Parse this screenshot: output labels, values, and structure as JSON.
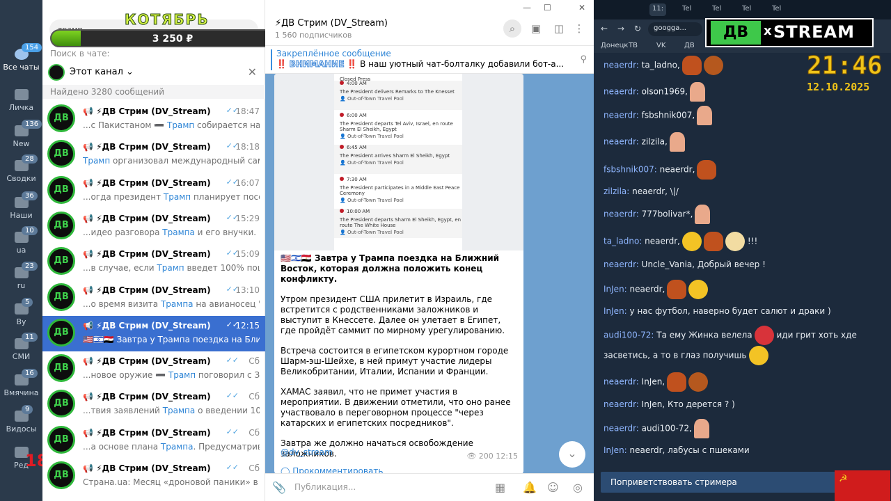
{
  "rail": {
    "items": [
      {
        "label": "Все чаты",
        "badge": "154"
      },
      {
        "label": "Личка",
        "badge": ""
      },
      {
        "label": "New",
        "badge": "136"
      },
      {
        "label": "Сводки",
        "badge": "28"
      },
      {
        "label": "Наши",
        "badge": "36"
      },
      {
        "label": "ua",
        "badge": "10"
      },
      {
        "label": "ru",
        "badge": "23"
      },
      {
        "label": "By",
        "badge": "5"
      },
      {
        "label": "СМИ",
        "badge": "11"
      },
      {
        "label": "Вмячина",
        "badge": "16"
      },
      {
        "label": "Видосы",
        "badge": "9"
      },
      {
        "label": "Ред",
        "badge": ""
      }
    ],
    "age_label": "18+"
  },
  "overlay": {
    "title": "КОТЯБРЬ",
    "amount": "3 250 ₽",
    "progress": 0.12
  },
  "list": {
    "search_value": "трамп",
    "search_in_chat": "Поиск в чате:",
    "channel_filter": "Этот канал",
    "found": "Найдено 3280 сообщений",
    "rows": [
      {
        "name": "📢 ⚡ДВ Стрим (DV_Stream)",
        "time": "18:47",
        "ticks": "✓✓",
        "pre": "...с Пакистаном ➖ ",
        "hl": "Трамп",
        "post": " собирается на Бли..."
      },
      {
        "name": "📢 ⚡ДВ Стрим (DV_Stream)",
        "time": "18:18",
        "ticks": "✓✓",
        "pre": "",
        "hl": "Трамп",
        "post": " организовал международный саммит п..."
      },
      {
        "name": "📢 ⚡ДВ Стрим (DV_Stream)",
        "time": "16:07",
        "ticks": "✓✓",
        "pre": "...огда президент ",
        "hl": "Трамп",
        "post": " планирует посетить Из..."
      },
      {
        "name": "📢 ⚡ДВ Стрим (DV_Stream)",
        "time": "15:29",
        "ticks": "✓✓",
        "pre": "...идео разговора ",
        "hl": "Трампа",
        "post": " и его внучки.   Вн..."
      },
      {
        "name": "📢 ⚡ДВ Стрим (DV_Stream)",
        "time": "15:09",
        "ticks": "✓✓",
        "pre": "...в случае, если ",
        "hl": "Трамп",
        "post": " введет 100% пошлины..."
      },
      {
        "name": "📢 ⚡ДВ Стрим (DV_Stream)",
        "time": "13:10",
        "ticks": "✓✓",
        "pre": "...о время визита ",
        "hl": "Трампа",
        "post": " на авианосец \"Гар..."
      },
      {
        "name": "📢 ⚡ДВ Стрим (DV_Stream)",
        "time": "12:15",
        "ticks": "✓✓",
        "pre": "🇺🇸🇮🇱🇪🇬 Завтра у Трампа поездка на Ближ...",
        "hl": "",
        "post": ""
      },
      {
        "name": "📢 ⚡ДВ Стрим (DV_Stream)",
        "time": "Сб",
        "ticks": "✓✓",
        "pre": "...новое оружие ➖ ",
        "hl": "Трамп",
        "post": " поговорил с З..."
      },
      {
        "name": "📢 ⚡ДВ Стрим (DV_Stream)",
        "time": "Сб",
        "ticks": "✓✓",
        "pre": "...твия заявлений ",
        "hl": "Трампа",
        "post": " о введении 100% по..."
      },
      {
        "name": "📢 ⚡ДВ Стрим (DV_Stream)",
        "time": "Сб",
        "ticks": "✓✓",
        "pre": "...а основе плана ",
        "hl": "Трампа",
        "post": ". Предусматривает..."
      },
      {
        "name": "📢 ⚡ДВ Стрим (DV_Stream)",
        "time": "Сб",
        "ticks": "✓✓",
        "pre": "Страна.ua: Месяц «дроновой паники» в Европе...",
        "hl": "",
        "post": ""
      }
    ]
  },
  "chat": {
    "title": "⚡ДВ Стрим (DV_Stream)",
    "subscribers": "1 560 подписчиков",
    "pinned_title": "Закреплённое сообщение",
    "pinned_warn": "‼️",
    "pinned_outline": "ВНИМАНИЕ",
    "pinned_text": " В наш уютный чат-болталку добавили бот-а...",
    "schedule": [
      {
        "time": "",
        "line": "Closed Press",
        "sub": ""
      },
      {
        "time": "4:00 AM",
        "line": "The President delivers Remarks to The Knesset",
        "sub": "Out-of-Town Travel Pool"
      },
      {
        "time": "6:00 AM",
        "line": "The President departs Tel Aviv, Israel, en route Sharm El Sheikh, Egypt",
        "sub": "Out-of-Town Travel Pool"
      },
      {
        "time": "6:45 AM",
        "line": "The President arrives Sharm El Sheikh, Egypt",
        "sub": "Out-of-Town Travel Pool"
      },
      {
        "time": "7:30 AM",
        "line": "The President participates in a Middle East Peace Ceremony",
        "sub": "Out-of-Town Travel Pool"
      },
      {
        "time": "10:00 AM",
        "line": "The President departs Sharm El Sheikh, Egypt, en route The White House",
        "sub": "Out-of-Town Travel Pool"
      }
    ],
    "message": {
      "headline": "🇺🇸🇮🇱🇪🇬 Завтра у Трампа поездка на Ближний Восток, которая должна положить конец конфликту.",
      "p1": "Утром президент США прилетит в Израиль, где встретится с родственниками заложников и выступит в Кнессете. Далее он улетает в Египет, где пройдёт саммит по мирному урегулированию.",
      "p2": "Встреча состоится в египетском курортном городе Шарм-эш-Шейхе, в ней примут участие лидеры Великобритании, Италии, Испании и Франции.",
      "p3": "ХАМАС заявил, что не примет участия в мероприятии. В движении отметили, что оно ранее участвовало в переговорном процессе \"через катарских и египетских посредников\".",
      "p4": "Завтра же должно начаться освобождение заложников.",
      "link": "@dv_stream",
      "views": "👁 200",
      "time": "12:15",
      "comment": "◯ Прокомментировать"
    },
    "composer_placeholder": "Публикация..."
  },
  "browser": {
    "tabs": [
      "11:",
      "Tel",
      "Tel",
      "Tel",
      "Tel"
    ],
    "url": "googga...",
    "bookmarks": [
      "Донецк",
      "ТВ",
      "VK",
      "ДВ"
    ],
    "logo_dv": "ДВ",
    "logo_x": "x",
    "logo_stream": "STREAM",
    "clock": "21:46",
    "date": "12.10.2025",
    "chat": [
      {
        "user": "neaerdr:",
        "text": " ta_ladno,",
        "emotes": [
          "bear",
          "lion"
        ]
      },
      {
        "user": "neaerdr:",
        "text": " olson1969,",
        "emotes": [
          "hand"
        ]
      },
      {
        "user": "neaerdr:",
        "text": " fsbshnik007,",
        "emotes": [
          "hand"
        ]
      },
      {
        "user": "neaerdr:",
        "text": " zilzila,",
        "emotes": [
          "hand"
        ]
      },
      {
        "user": "fsbshnik007:",
        "text": " neaerdr,",
        "emotes": [
          "bear"
        ]
      },
      {
        "user": "zilzila:",
        "text": " neaerdr, \\|/",
        "emotes": []
      },
      {
        "user": "neaerdr:",
        "text": " 777bolivar*,",
        "emotes": [
          "hand"
        ]
      },
      {
        "user": "ta_ladno:",
        "text": " neaerdr,",
        "emotes": [
          "yellow",
          "bear",
          "pale"
        ]
      },
      {
        "user": "neaerdr:",
        "text": " Uncle_Vania, Добрый вечер !",
        "emotes": []
      },
      {
        "user": "InJen:",
        "text": " neaerdr,",
        "emotes": [
          "bear",
          "yellow"
        ]
      },
      {
        "user": "InJen:",
        "text": " у нас футбол, наверно будет салют и драки )",
        "emotes": []
      },
      {
        "user": "audi100-72:",
        "text": " Та ему Жинка велела",
        "emotes": [
          "cartman"
        ]
      },
      {
        "user": "",
        "text": "засветись, а то в глаз получишь",
        "emotes": [
          "yellow"
        ]
      },
      {
        "user": "neaerdr:",
        "text": " InJen,",
        "emotes": [
          "bear",
          "lion"
        ]
      },
      {
        "user": "neaerdr:",
        "text": " InJen, Кто дерется ? )",
        "emotes": []
      },
      {
        "user": "neaerdr:",
        "text": " audi100-72,",
        "emotes": [
          "hand"
        ]
      },
      {
        "user": "InJen:",
        "text": " neaerdr, лабусы с пшеками",
        "emotes": []
      }
    ],
    "chat_extra": "!!!",
    "chat_extra2": "иди грит хоть хде",
    "greet": "Поприветствовать стримера",
    "flag": "☭"
  }
}
